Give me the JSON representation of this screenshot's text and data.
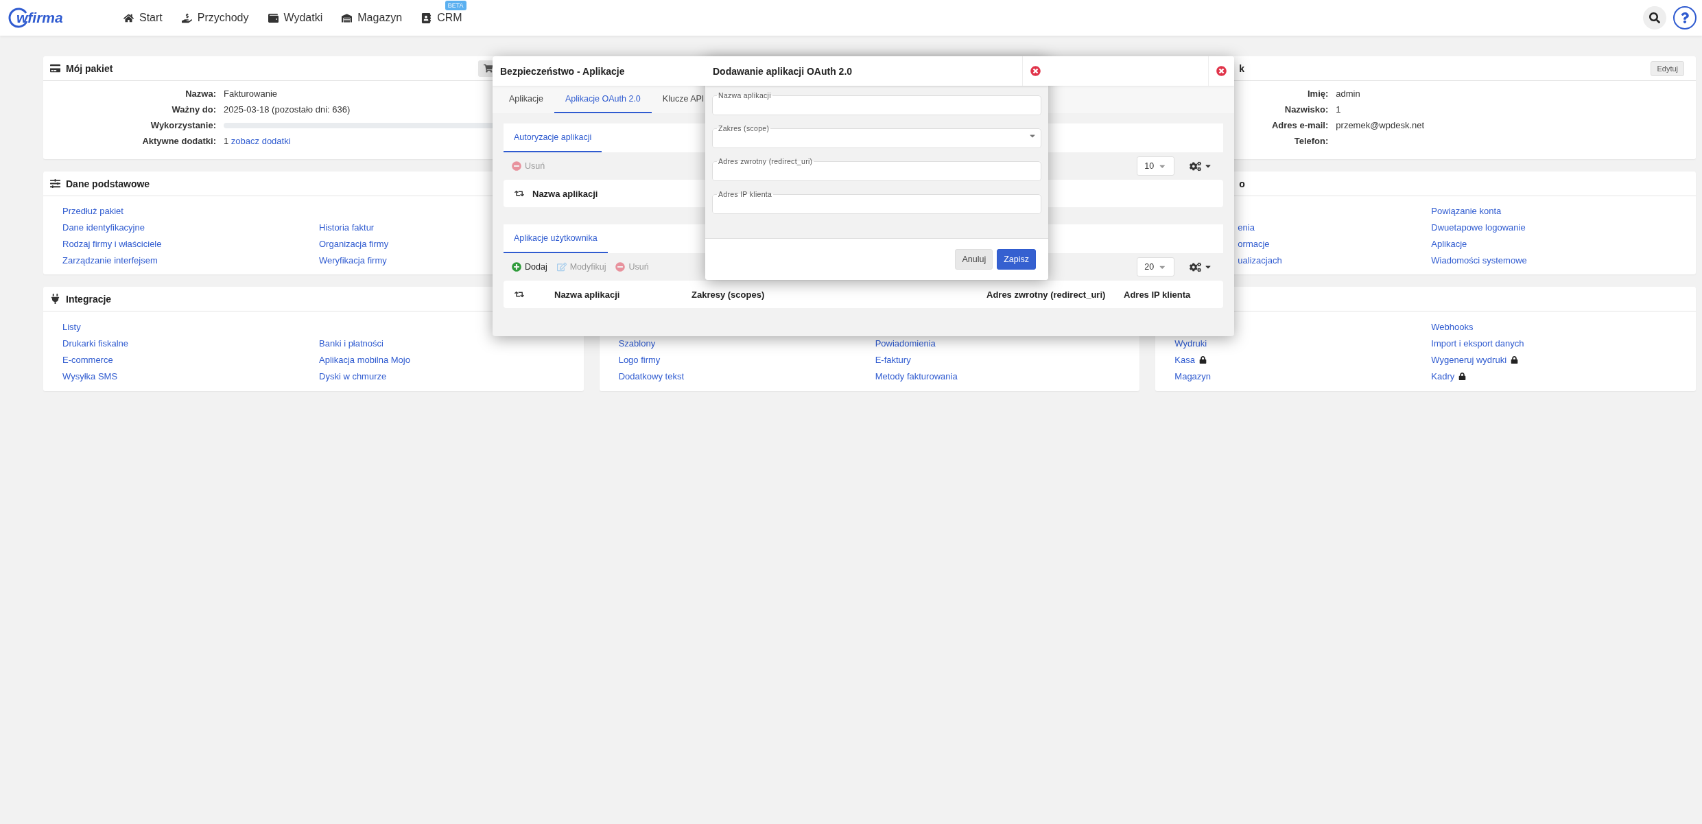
{
  "header": {
    "logo": "wfirma",
    "nav": [
      {
        "label": "Start"
      },
      {
        "label": "Przychody"
      },
      {
        "label": "Wydatki"
      },
      {
        "label": "Magazyn"
      },
      {
        "label": "CRM",
        "badge": "BETA"
      }
    ]
  },
  "columns": [
    {
      "panels": [
        {
          "kind": "fields",
          "title": "Mój pakiet",
          "action": {
            "kind": "cart"
          },
          "fields": [
            {
              "label": "Nazwa:",
              "value": "Fakturowanie"
            },
            {
              "label": "Ważny do:",
              "value": "2025-03-18 (pozostało dni: 636)"
            },
            {
              "label": "Wykorzystanie:",
              "level": 0
            },
            {
              "label": "Aktywne dodatki:",
              "value": "1",
              "link": "zobacz dodatki"
            }
          ]
        },
        {
          "kind": "links",
          "title": "Dane podstawowe",
          "link_columns": [
            [
              {
                "label": "Przedłuż pakiet",
                "locked": false
              },
              {
                "label": "Dane identyfikacyjne",
                "locked": false
              },
              {
                "label": "Rodzaj firmy i właściciele",
                "locked": false
              },
              {
                "label": "Zarządzanie interfejsem",
                "locked": false
              }
            ],
            [
              {
                "label": "Historia faktur",
                "locked": false
              },
              {
                "label": "Organizacja firmy",
                "locked": false
              },
              {
                "label": "Weryfikacja firmy",
                "locked": false
              }
            ]
          ]
        },
        {
          "kind": "links",
          "title": "Integracje",
          "link_columns": [
            [
              {
                "label": "Listy",
                "locked": false
              },
              {
                "label": "Drukarki fiskalne",
                "locked": false
              },
              {
                "label": "E-commerce",
                "locked": false
              },
              {
                "label": "Wysyłka SMS",
                "locked": false
              }
            ],
            [
              {
                "label": "Banki i płatności",
                "locked": false
              },
              {
                "label": "Aplikacja mobilna Mojo",
                "locked": false
              },
              {
                "label": "Dyski w chmurze",
                "locked": false
              }
            ]
          ]
        }
      ]
    },
    {
      "panels": [
        {
          "kind": "links",
          "link_columns": [
            [
              {
                "label": "Szablony",
                "locked": false
              },
              {
                "label": "Logo firmy",
                "locked": false
              },
              {
                "label": "Dodatkowy tekst",
                "locked": false
              }
            ],
            [
              {
                "label": "Powiadomienia",
                "locked": false
              },
              {
                "label": "E-faktury",
                "locked": false
              },
              {
                "label": "Metody fakturowania",
                "locked": false
              }
            ]
          ]
        }
      ]
    },
    {
      "panels": [
        {
          "kind": "fields",
          "title": "k",
          "title_partial": true,
          "action": {
            "kind": "text",
            "label": "Edytuj"
          },
          "fields": [
            {
              "label": "Imię:",
              "value": "admin"
            },
            {
              "label": "Nazwisko:",
              "value": "1"
            },
            {
              "label": "Adres e-mail:",
              "value": "przemek@wpdesk.net"
            },
            {
              "label": "Telefon:"
            }
          ]
        },
        {
          "kind": "links",
          "title": "o",
          "title_partial": true,
          "link_columns": [
            [
              {
                "label": "enia",
                "locked": false,
                "partial": true
              },
              {
                "label": "ormacje",
                "locked": false,
                "partial": true
              },
              {
                "label": "ualizacjach",
                "locked": false,
                "partial": true
              }
            ],
            [
              {
                "label": "Powiązanie konta",
                "locked": false
              },
              {
                "label": "Dwuetapowe logowanie",
                "locked": false
              },
              {
                "label": "Aplikacje",
                "locked": false
              },
              {
                "label": "Wiadomości systemowe",
                "locked": false
              }
            ]
          ]
        },
        {
          "kind": "links",
          "link_columns": [
            [
              {
                "label": "Wydruki",
                "locked": false
              },
              {
                "label": "Kasa",
                "locked": true
              },
              {
                "label": "Magazyn",
                "locked": false
              }
            ],
            [
              {
                "label": "Webhooks",
                "locked": false
              },
              {
                "label": "Import i eksport danych",
                "locked": false
              },
              {
                "label": "Wygeneruj wydruki",
                "locked": true
              },
              {
                "label": "Kadry",
                "locked": true
              }
            ]
          ]
        }
      ]
    }
  ],
  "security_dialog": {
    "title": "Bezpieczeństwo - Aplikacje",
    "tabs": [
      {
        "label": "Aplikacje",
        "selected": false
      },
      {
        "label": "Aplikacje OAuth 2.0",
        "selected": true
      },
      {
        "label": "Klucze API",
        "selected": false
      }
    ],
    "sections": [
      {
        "tab": "Autoryzacje aplikacji",
        "toolbar": [
          {
            "kind": "remove",
            "label": "Usuń",
            "disabled": true
          }
        ],
        "page_size": "10",
        "columns": [
          "Nazwa aplikacji"
        ]
      },
      {
        "tab": "Aplikacje użytkownika",
        "toolbar": [
          {
            "kind": "add",
            "label": "Dodaj",
            "disabled": false
          },
          {
            "kind": "edit",
            "label": "Modyfikuj",
            "disabled": true
          },
          {
            "kind": "remove",
            "label": "Usuń",
            "disabled": true
          }
        ],
        "page_size": "20",
        "columns": [
          "Nazwa aplikacji",
          "Zakresy (scopes)",
          "Adres zwrotny (redirect_uri)",
          "Adres IP klienta"
        ]
      }
    ]
  },
  "add_dialog": {
    "title": "Dodawanie aplikacji OAuth 2.0",
    "fields": [
      {
        "label": "Nazwa aplikacji",
        "kind": "text"
      },
      {
        "label": "Zakres (scope)",
        "kind": "select"
      },
      {
        "label": "Adres zwrotny (redirect_uri)",
        "kind": "text"
      },
      {
        "label": "Adres IP klienta",
        "kind": "text"
      }
    ],
    "buttons": [
      {
        "label": "Anuluj",
        "kind": "secondary"
      },
      {
        "label": "Zapisz",
        "kind": "primary"
      }
    ]
  }
}
